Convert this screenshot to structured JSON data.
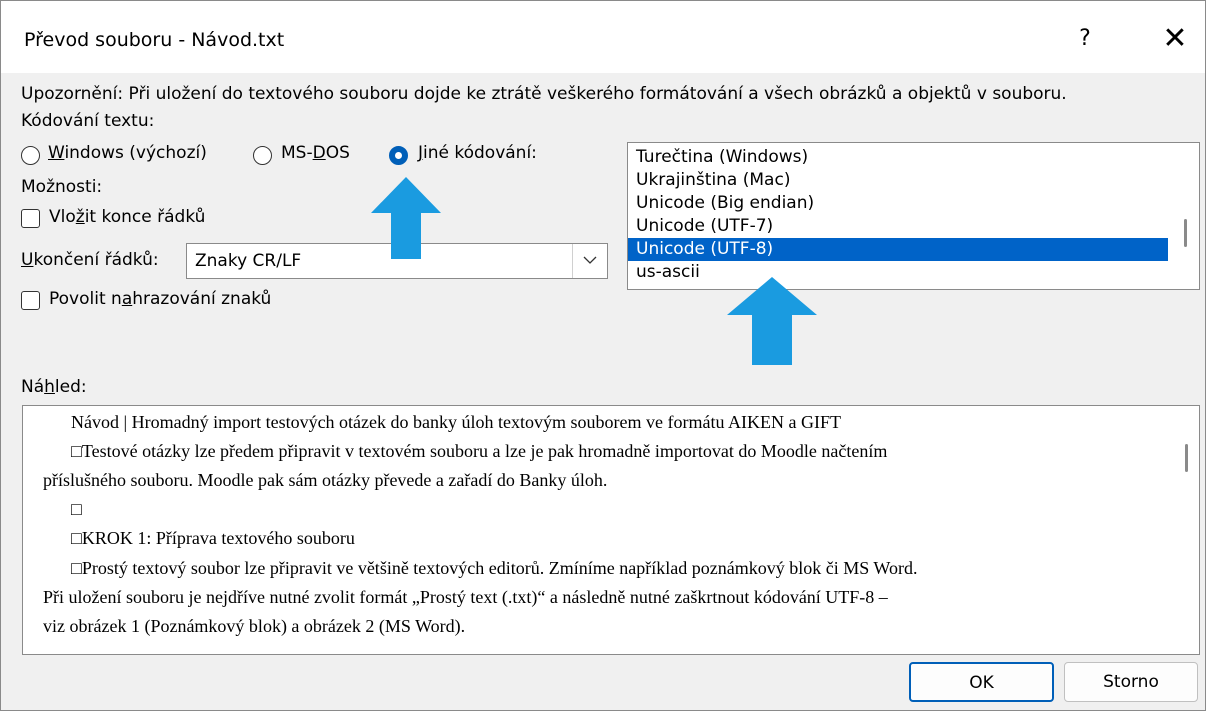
{
  "dialog": {
    "title": "Převod souboru - Návod.txt",
    "help_label": "?",
    "close_label": "✕"
  },
  "warning_text": "Upozornění: Při uložení do textového souboru dojde ke ztrátě veškerého formátování a všech obrázků a objektů v souboru.",
  "encoding": {
    "label": "Kódování textu:",
    "options": [
      {
        "label_pre": "",
        "label_u": "W",
        "label_post": "indows (výchozí)",
        "selected": false
      },
      {
        "label_pre": "MS-",
        "label_u": "D",
        "label_post": "OS",
        "selected": false
      },
      {
        "label_pre": "",
        "label_u": "J",
        "label_post": "iné kódování:",
        "selected": true
      }
    ],
    "list_items": [
      "Turečtina (Windows)",
      "Ukrajinština (Mac)",
      "Unicode (Big endian)",
      "Unicode (UTF-7)",
      "Unicode (UTF-8)",
      "us-ascii"
    ],
    "selected_item": "Unicode (UTF-8)"
  },
  "options": {
    "label": "Možnosti:",
    "insert_line_breaks": {
      "pre": "Vlo",
      "u": "ž",
      "post": "it konce řádků",
      "checked": false
    },
    "line_endings": {
      "pre": "",
      "u": "U",
      "post": "končení řádků:",
      "value": "Znaky CR/LF"
    },
    "allow_substitution": {
      "pre": "Povolit n",
      "u": "a",
      "post": "hrazování znaků",
      "checked": false
    }
  },
  "preview": {
    "label_pre": "Ná",
    "label_u": "h",
    "label_post": "led:",
    "lines": [
      "Návod | Hromadný import testových otázek do banky úloh textovým souborem ve formátu AIKEN a GIFT",
      "□Testové otázky lze předem připravit v textovém souboru a lze je pak hromadně importovat do Moodle načtením",
      "příslušného souboru. Moodle pak sám otázky převede a zařadí do Banky úloh.",
      "□",
      "□KROK 1: Příprava textového souboru",
      "□Prostý textový soubor lze připravit ve většině textových editorů. Zmíníme například poznámkový blok či MS Word.",
      "Při uložení souboru je nejdříve nutné zvolit formát „Prostý text (.txt)“ a následně nutné zaškrtnout kódování UTF-8 –",
      "viz obrázek 1 (Poznámkový blok) a obrázek 2 (MS Word)."
    ]
  },
  "buttons": {
    "ok": "OK",
    "cancel": "Storno"
  },
  "colors": {
    "accent": "#005fb8",
    "selection": "#0063c8",
    "annotation_arrow": "#1a9be0"
  }
}
